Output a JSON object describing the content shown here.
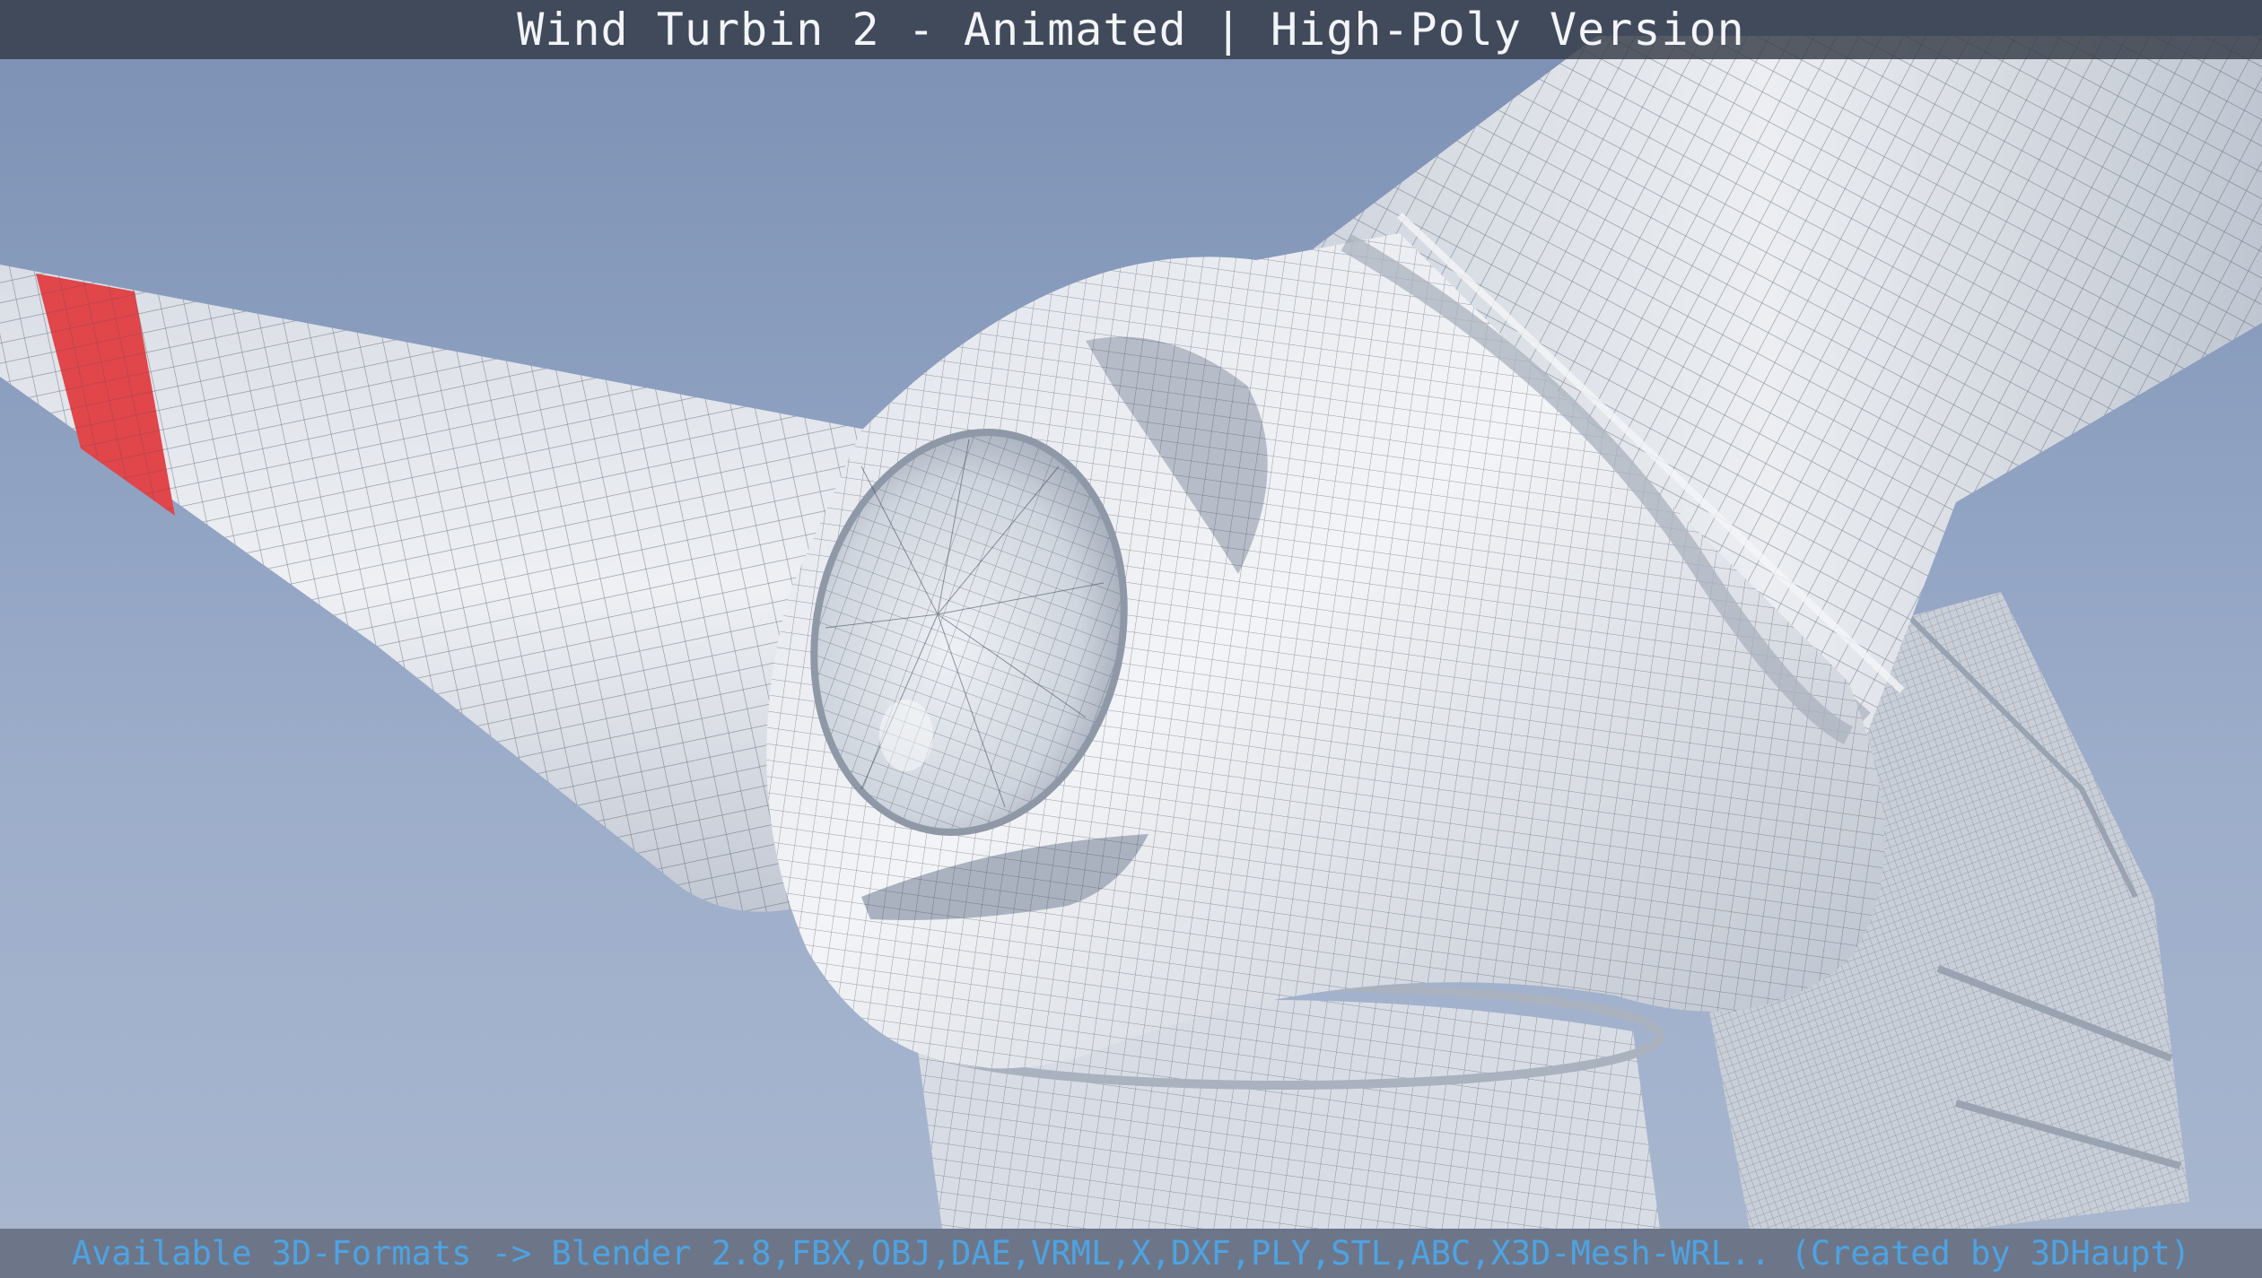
{
  "header": {
    "title": "Wind Turbin 2 - Animated | High-Poly Version"
  },
  "footer": {
    "formats": "Available 3D-Formats -> Blender 2.8,FBX,OBJ,DAE,VRML,X,DXF,PLY,STL,ABC,X3D-Mesh-WRL.. (Created by 3DHaupt)"
  },
  "colors": {
    "sky": "#8fa3c4",
    "mesh_surface": "#e6e9ee",
    "wireframe": "#3d4654",
    "blade_stripe": "#e0464a",
    "footer_text": "#4da3e3",
    "title_text": "#f2f4f7"
  },
  "scene": {
    "subject": "wind-turbine-hub-wireframe"
  }
}
